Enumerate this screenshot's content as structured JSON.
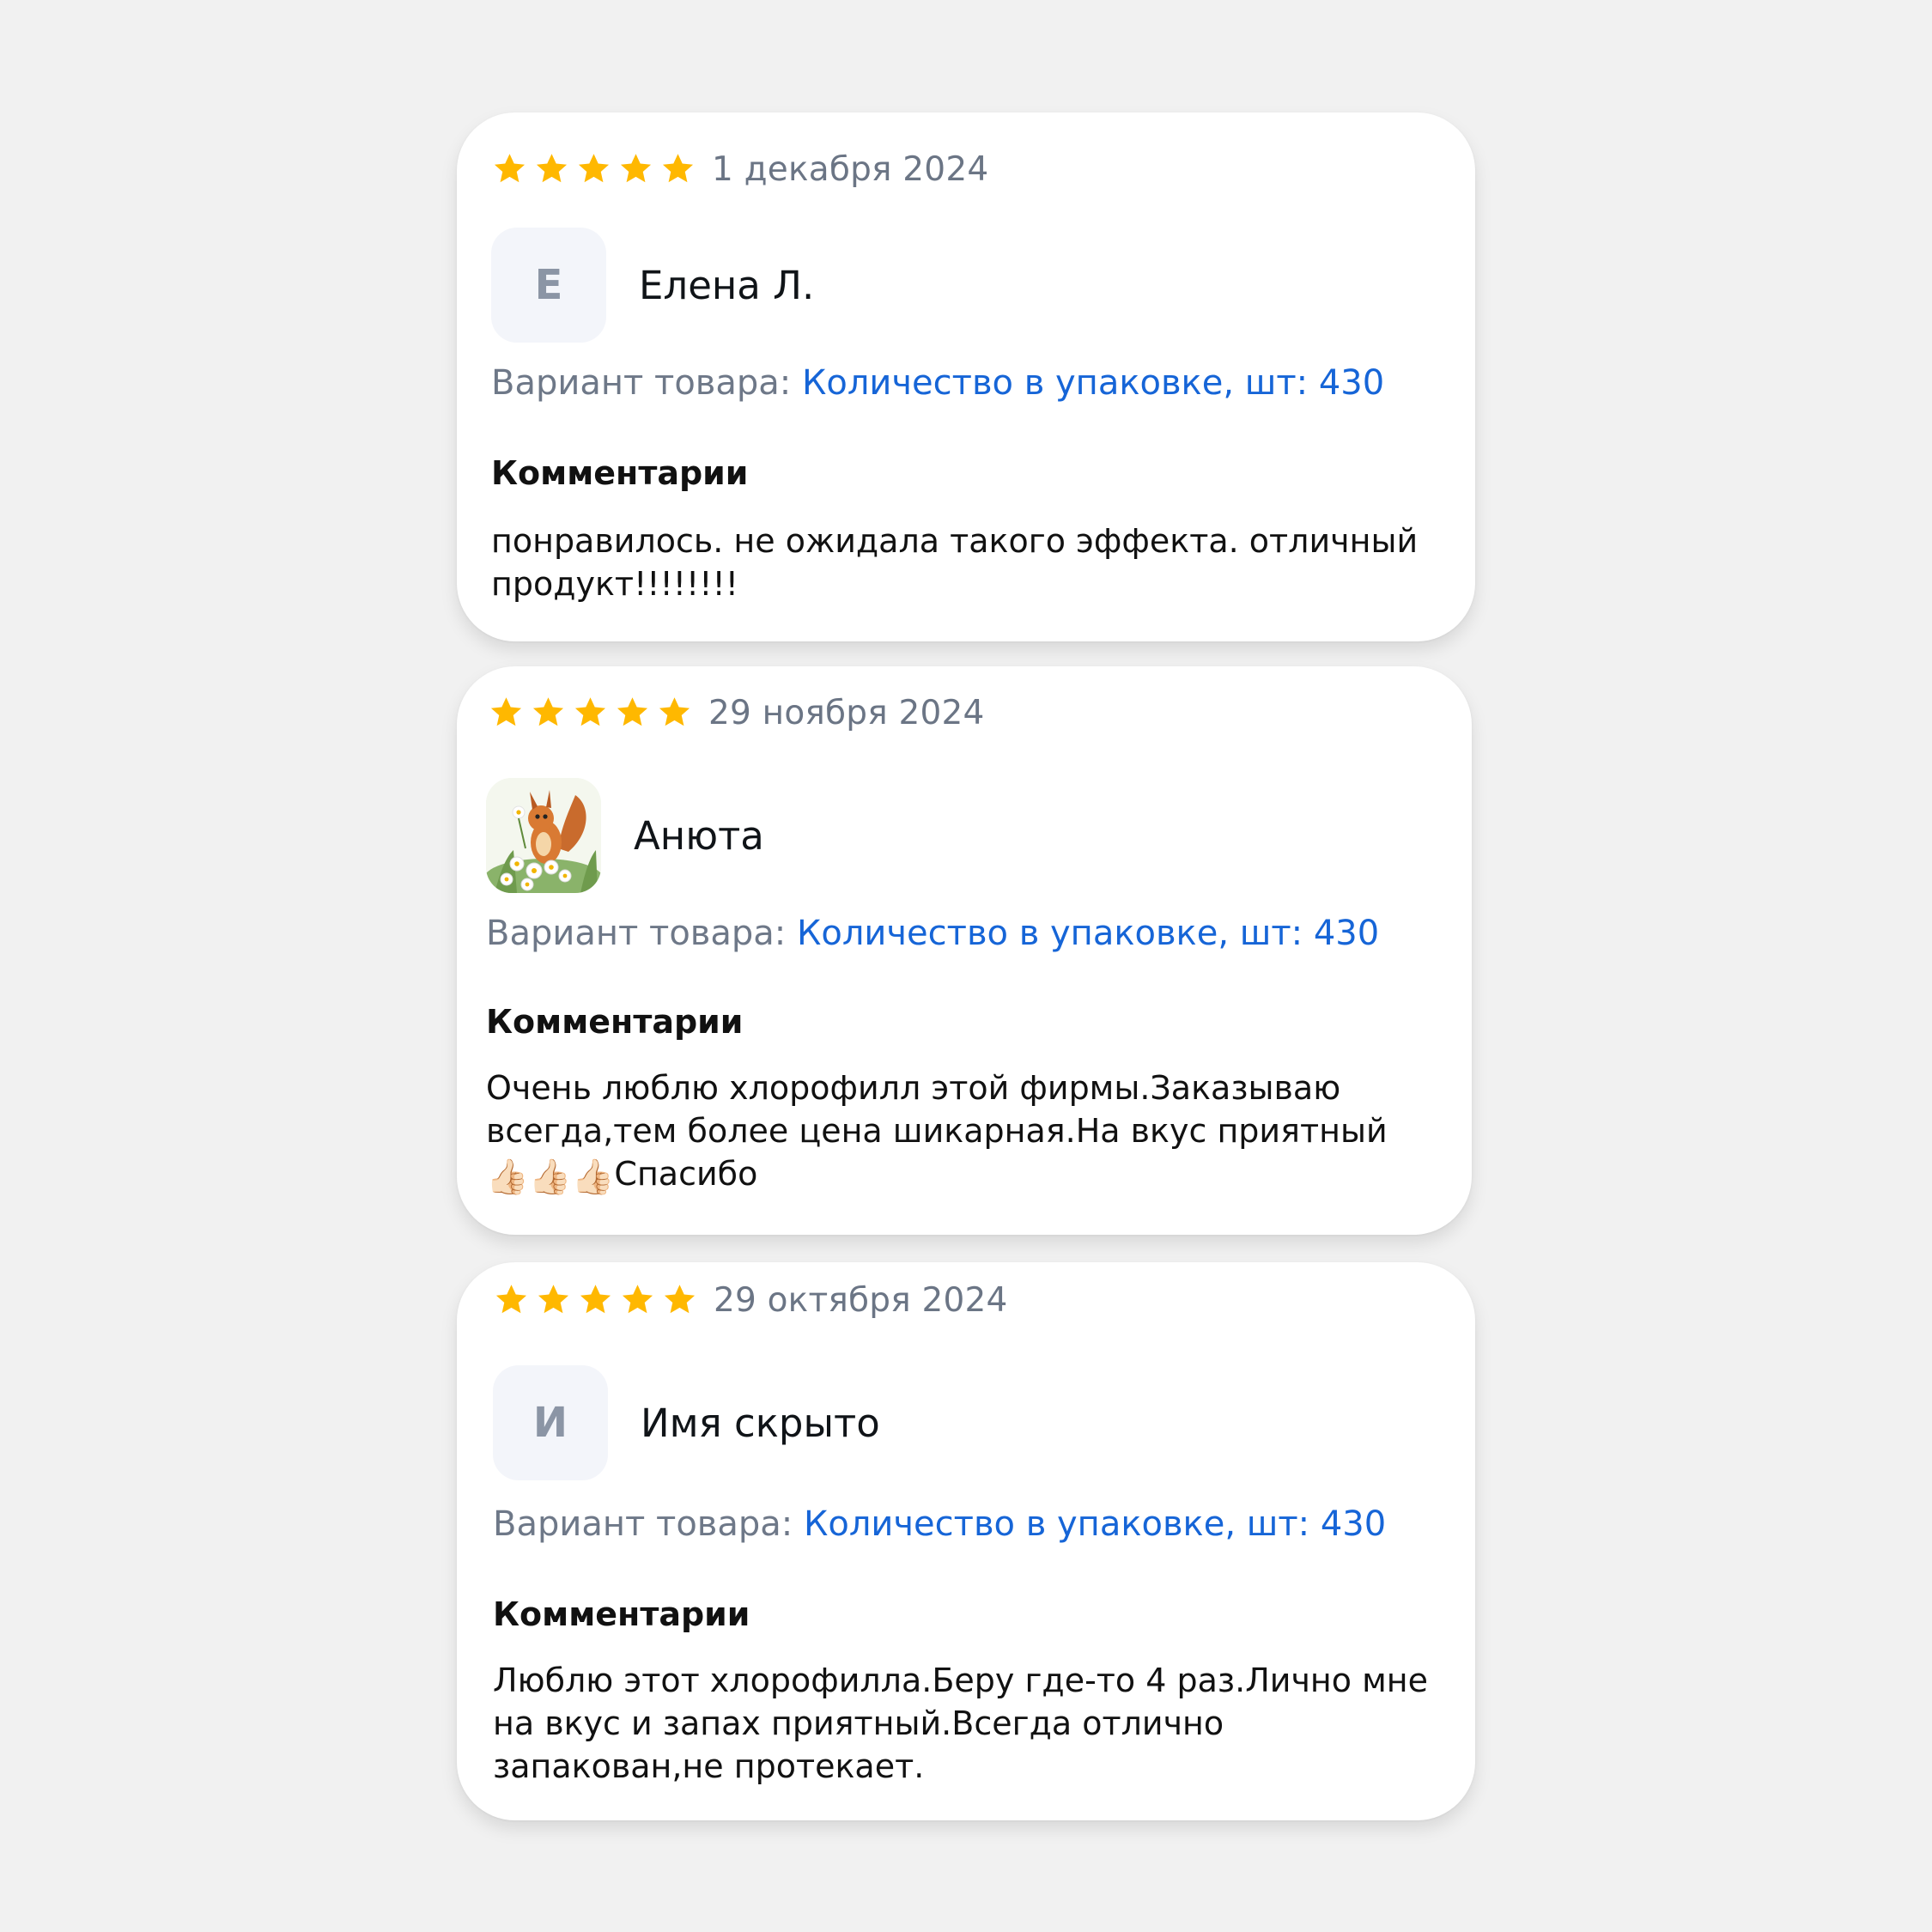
{
  "colors": {
    "background": "#f1f1f1",
    "card": "#ffffff",
    "star": "#ffb800",
    "date": "#6b7585",
    "variant_label": "#6e7888",
    "variant_value": "#1665d7",
    "avatar_bg": "#f3f5fa",
    "avatar_letter": "#8b95a5"
  },
  "reviews": [
    {
      "rating": 5,
      "date": "1 декабря 2024",
      "avatar_letter": "Е",
      "author": "Елена Л.",
      "variant_label": "Вариант товара:",
      "variant_value": "Количество в упаковке, шт: 430",
      "comment_title": "Комментарии",
      "comment": "понравилось. не ожидала такого эффекта. отличный продукт!!!!!!!!"
    },
    {
      "rating": 5,
      "date": "29 ноября 2024",
      "avatar_icon": "squirrel-with-daisies-avatar",
      "author": "Анюта",
      "variant_label": "Вариант товара:",
      "variant_value": "Количество в упаковке, шт: 430",
      "comment_title": "Комментарии",
      "comment_part1": "Очень люблю хлорофилл этой фирмы.Заказываю всегда,тем более цена шикарная.На вкус приятный",
      "thumbs": "👍🏻👍🏻👍🏻",
      "comment_part2": "Спасибо"
    },
    {
      "rating": 5,
      "date": "29 октября 2024",
      "avatar_letter": "И",
      "author": "Имя скрыто",
      "variant_label": "Вариант товара:",
      "variant_value": "Количество в упаковке, шт: 430",
      "comment_title": "Комментарии",
      "comment": "Люблю этот хлорофилла.Беру где-то 4 раз.Лично мне на вкус и запах приятный.Всегда отлично запакован,не протекает."
    }
  ]
}
